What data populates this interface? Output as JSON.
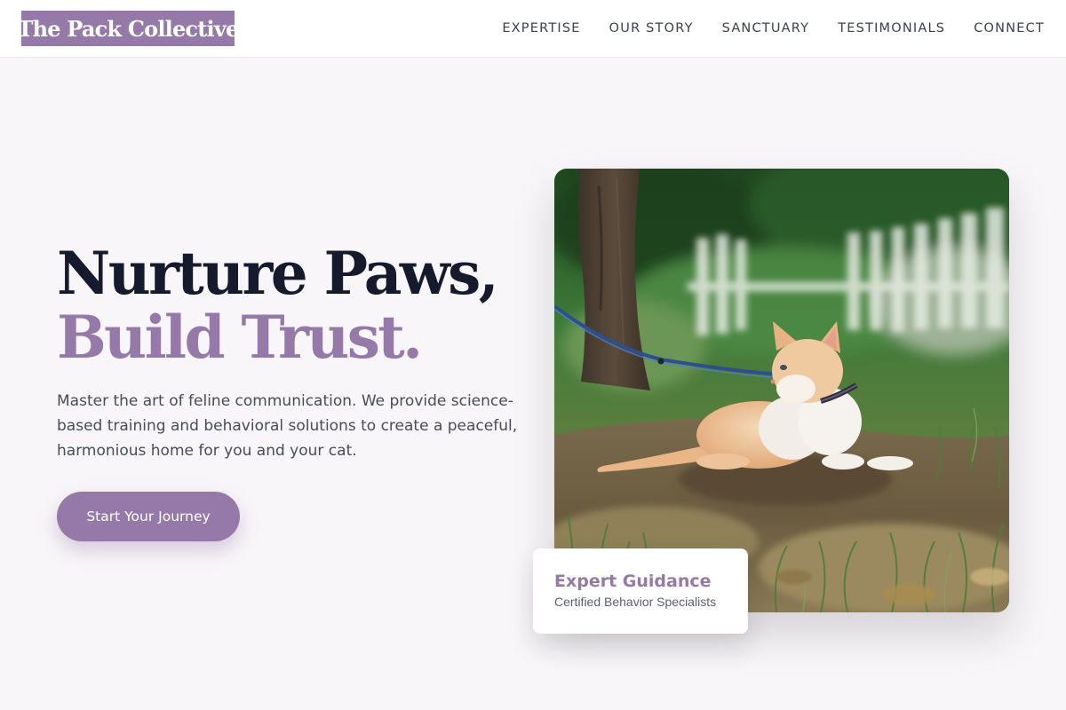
{
  "header": {
    "logo": "The Pack Collective",
    "nav": [
      "EXPERTISE",
      "OUR STORY",
      "SANCTUARY",
      "TESTIMONIALS",
      "CONNECT"
    ]
  },
  "hero": {
    "title_line1": "Nurture Paws,",
    "title_line2": "Build Trust.",
    "description": "Master the art of feline communication. We provide science-based training and behavioral solutions to create a peaceful, harmonious home for you and your cat.",
    "cta_label": "Start Your Journey",
    "image_alt": "Orange and white kitten on a blue leash sitting in grass"
  },
  "card": {
    "title": "Expert Guidance",
    "subtitle": "Certified Behavior Specialists"
  },
  "colors": {
    "brand": "#9479a9",
    "heading": "#151b2d",
    "body_text": "#474c59",
    "page_background": "#f8f6f8"
  }
}
